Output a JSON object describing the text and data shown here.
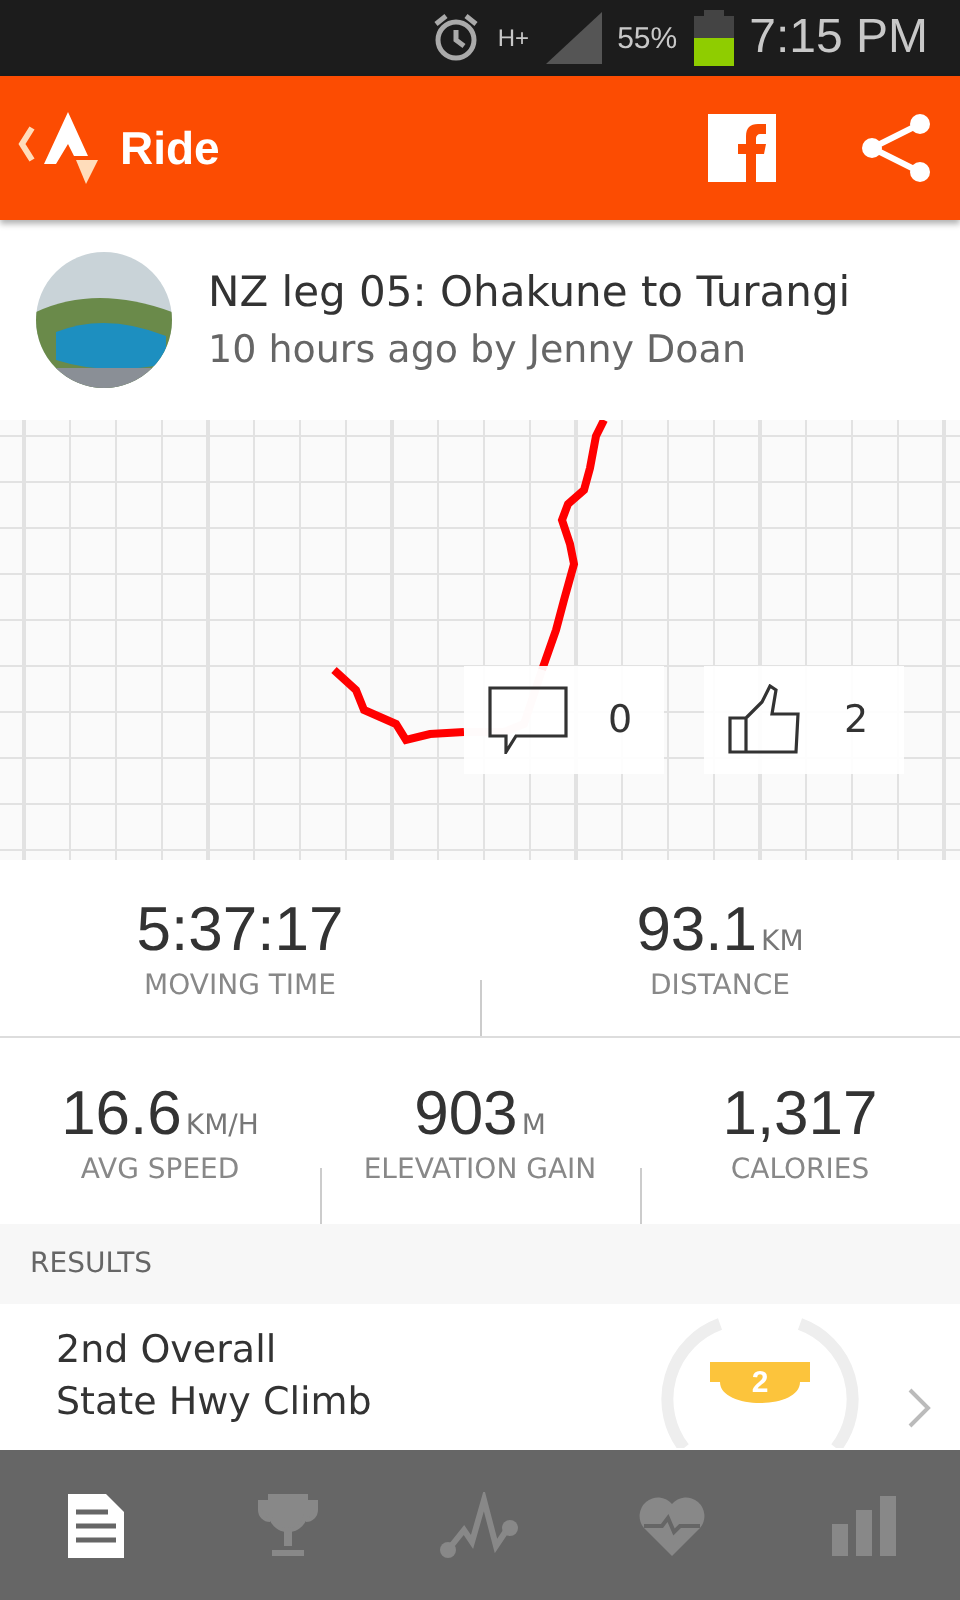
{
  "status_bar": {
    "network": "H+",
    "battery": "55%",
    "time": "7:15 PM"
  },
  "app_bar": {
    "title": "Ride"
  },
  "activity": {
    "title": "NZ leg 05: Ohakune to Turangi",
    "subtitle": "10 hours ago by Jenny Doan"
  },
  "map": {
    "kind": "picture"
  },
  "social": {
    "comments": "0",
    "kudos": "2"
  },
  "stats": [
    [
      {
        "value": "5:37:17",
        "label": "MOVING TIME"
      },
      {
        "value": "93.1",
        "unit": "KM",
        "label": "DISTANCE"
      }
    ],
    [
      {
        "value": "16.6",
        "unit": "KM/H",
        "label": "AVG SPEED"
      },
      {
        "value": "903",
        "unit": "M",
        "label": "ELEVATION GAIN"
      },
      {
        "value": "1,317",
        "label": "CALORIES"
      }
    ]
  ],
  "results": {
    "header": "RESULTS",
    "items": [
      {
        "title": "2nd Overall",
        "subtitle": "State Hwy Climb",
        "rank": "2"
      }
    ]
  },
  "tab_bar": [
    {
      "kind": "overview",
      "selected": true
    },
    {
      "kind": "trophy",
      "selected": false
    },
    {
      "kind": "analysis",
      "selected": false
    },
    {
      "kind": "heart",
      "selected": false
    },
    {
      "kind": "stats",
      "selected": false
    }
  ]
}
